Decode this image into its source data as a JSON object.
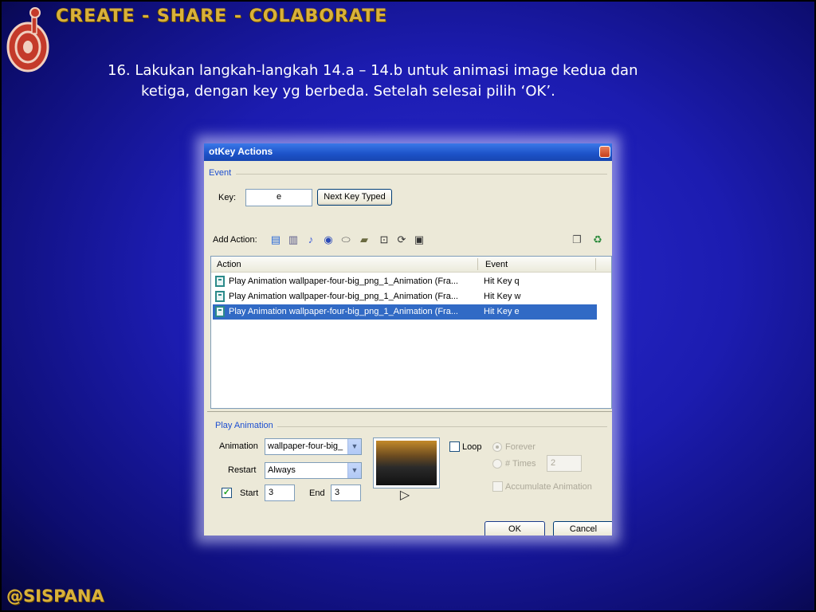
{
  "header": {
    "title": "CREATE - SHARE - COLABORATE"
  },
  "instruction": {
    "line1": "16. Lakukan langkah-langkah 14.a – 14.b  untuk animasi image kedua dan",
    "line2": "ketiga, dengan key yg berbeda. Setelah selesai pilih ‘OK’."
  },
  "dialog": {
    "title": "otKey Actions",
    "event_legend": "Event",
    "key_label": "Key:",
    "key_value": "e",
    "next_key_button": "Next Key Typed",
    "add_action_label": "Add Action:",
    "columns": {
      "action": "Action",
      "event": "Event"
    },
    "rows": [
      {
        "action": "Play Animation wallpaper-four-big_png_1_Animation (Fra...",
        "event": "Hit Key q",
        "selected": false
      },
      {
        "action": "Play Animation wallpaper-four-big_png_1_Animation (Fra...",
        "event": "Hit Key w",
        "selected": false
      },
      {
        "action": "Play Animation wallpaper-four-big_png_1_Animation (Fra...",
        "event": "Hit Key e",
        "selected": true
      }
    ],
    "play_animation_legend": "Play Animation",
    "animation_label": "Animation",
    "animation_value": "wallpaper-four-big_",
    "restart_label": "Restart",
    "restart_value": "Always",
    "start_label": "Start",
    "start_value": "3",
    "end_label": "End",
    "end_value": "3",
    "loop_label": "Loop",
    "forever_label": "Forever",
    "times_label": "# Times",
    "times_value": "2",
    "accumulate_label": "Accumulate Animation",
    "ok_button": "OK",
    "cancel_button": "Cancel"
  },
  "footer": {
    "tag": "@SISPANA"
  },
  "colors": {
    "background": "#1c1cb0",
    "header_text": "#d9b13a",
    "selection": "#316ac5"
  }
}
